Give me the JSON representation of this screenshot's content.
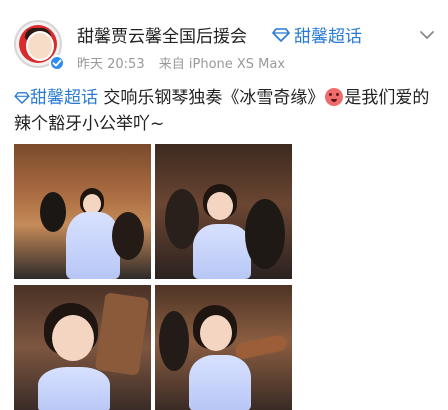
{
  "user": {
    "name": "甜馨贾云馨全国后援会",
    "avatar_alt": "profile avatar",
    "verified": true
  },
  "topic_chip": {
    "label": "甜馨超话"
  },
  "meta": {
    "time": "昨天 20:53",
    "source": "来自 iPhone XS Max"
  },
  "post": {
    "topic": "甜馨超话",
    "text_a": " 交响乐钢琴独奏《冰雪奇缘》",
    "text_b": "是我们爱的辣个豁牙小公举吖~"
  },
  "photos": [
    {
      "watermark": ""
    },
    {
      "watermark": ""
    },
    {
      "watermark": ""
    },
    {
      "watermark": ""
    }
  ],
  "icons": {
    "topic": "diamond-topic-icon",
    "chevron": "chevron-down-icon",
    "verified": "verified-badge-icon",
    "emoji": "emoji-icon"
  },
  "colors": {
    "link": "#2a7bd3",
    "verified": "#2e8bf0"
  }
}
